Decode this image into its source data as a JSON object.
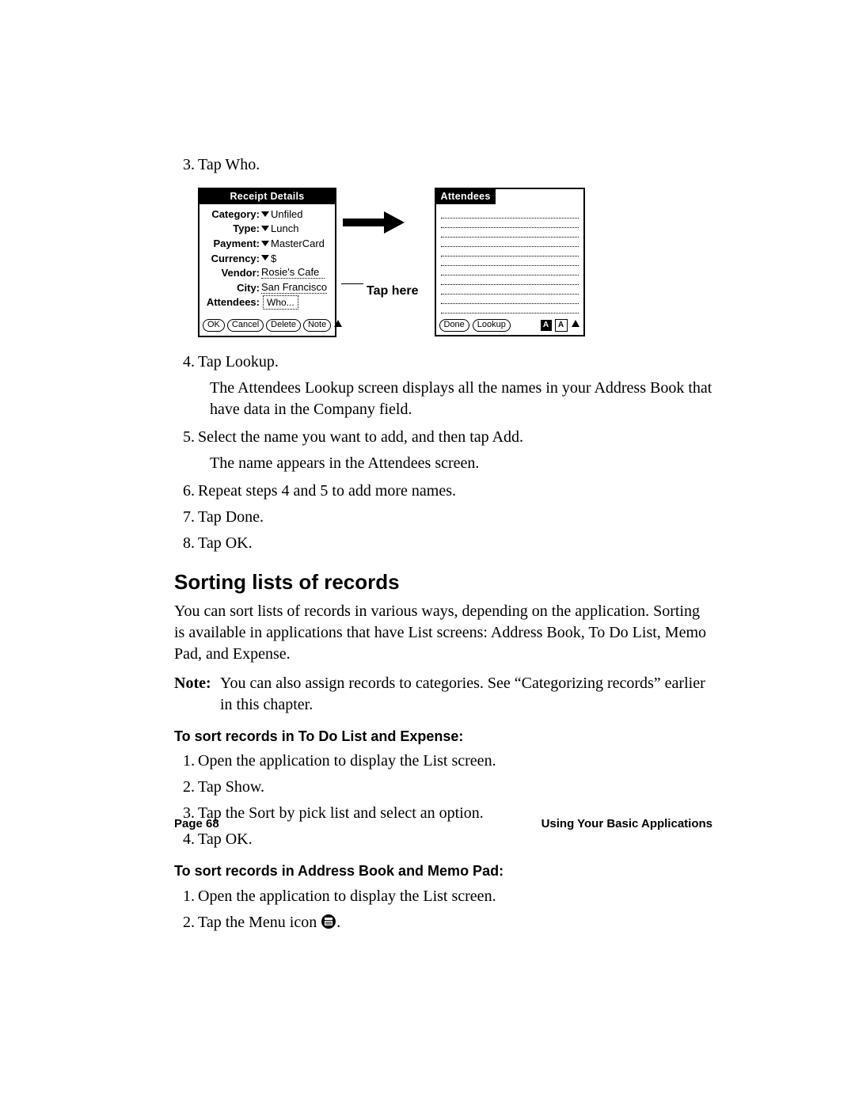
{
  "steps_a": {
    "3": "Tap Who.",
    "4": "Tap Lookup.",
    "4_sub": "The Attendees Lookup screen displays all the names in your Address Book that have data in the Company field.",
    "5": "Select the name you want to add, and then tap Add.",
    "5_sub": "The name appears in the Attendees screen.",
    "6": "Repeat steps 4 and 5 to add more names.",
    "7": "Tap Done.",
    "8": "Tap OK."
  },
  "section_heading": "Sorting lists of records",
  "section_intro": "You can sort lists of records in various ways, depending on the application. Sorting is available in applications that have List screens: Address Book, To Do List, Memo Pad, and Expense.",
  "note_label": "Note:",
  "note_text": "You can also assign records to categories. See “Categorizing records” earlier in this chapter.",
  "proc1_head": "To sort records in To Do List and Expense:",
  "proc1": {
    "1": "Open the application to display the List screen.",
    "2": "Tap Show.",
    "3": "Tap the Sort by pick list and select an option.",
    "4": "Tap OK."
  },
  "proc2_head": "To sort records in Address Book and Memo Pad:",
  "proc2": {
    "1": "Open the application to display the List screen.",
    "2a": "Tap the Menu icon ",
    "2b": "."
  },
  "figure": {
    "tap_here": "Tap here",
    "receipt": {
      "title": "Receipt Details",
      "labels": {
        "category": "Category:",
        "type": "Type:",
        "payment": "Payment:",
        "currency": "Currency:",
        "vendor": "Vendor:",
        "city": "City:",
        "attendees": "Attendees:"
      },
      "values": {
        "category": "Unfiled",
        "type": "Lunch",
        "payment": "MasterCard",
        "currency": "$",
        "vendor": "Rosie's Cafe",
        "city": "San Francisco",
        "who": "Who..."
      },
      "buttons": {
        "ok": "OK",
        "cancel": "Cancel",
        "delete": "Delete",
        "note": "Note"
      }
    },
    "attendees": {
      "title": "Attendees",
      "buttons": {
        "done": "Done",
        "lookup": "Lookup"
      },
      "key_a": "A",
      "key_a2": "A"
    }
  },
  "footer": {
    "page": "Page 68",
    "title": "Using Your Basic Applications"
  }
}
